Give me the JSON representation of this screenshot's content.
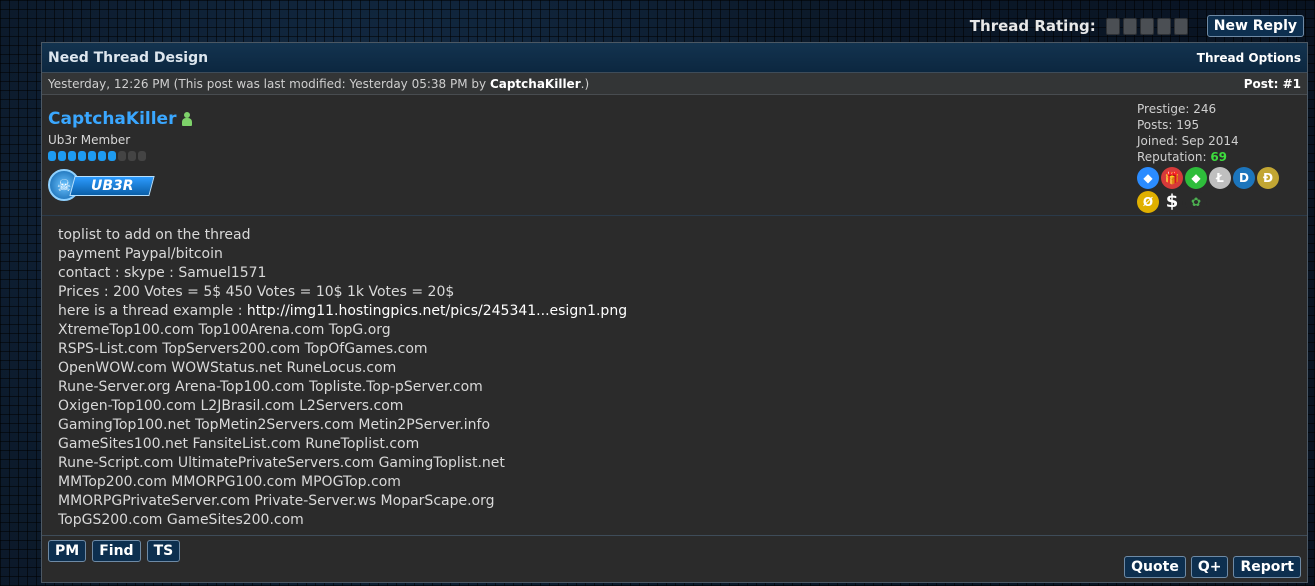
{
  "topbar": {
    "rating_label": "Thread Rating:",
    "new_reply": "New Reply"
  },
  "thread": {
    "title": "Need Thread Design",
    "options_label": "Thread Options"
  },
  "meta": {
    "date_text": "Yesterday, 12:26 PM (This post was last modified: Yesterday 05:38 PM by ",
    "modified_by": "CaptchaKiller",
    "date_suffix": ".)",
    "post_number": "Post: #1"
  },
  "author": {
    "username": "CaptchaKiller",
    "usertitle": "Ub3r Member",
    "group_badge": "UB3R",
    "stats": {
      "prestige": "Prestige: 246",
      "posts": "Posts: 195",
      "joined": "Joined: Sep 2014",
      "reputation_label": "Reputation:",
      "reputation_value": "69"
    },
    "rank_level": 7,
    "rank_max": 10,
    "awards": [
      {
        "icon": "diamond-icon",
        "color": "#2b8cff",
        "glyph": "◆"
      },
      {
        "icon": "gift-icon",
        "color": "#d63a3a",
        "glyph": "🎁"
      },
      {
        "icon": "emerald-icon",
        "color": "#2ebd3b",
        "glyph": "◆"
      },
      {
        "icon": "litecoin-icon",
        "color": "#bfbfbf",
        "glyph": "Ł"
      },
      {
        "icon": "dash-icon",
        "color": "#1c75bc",
        "glyph": "D"
      },
      {
        "icon": "dogecoin-icon",
        "color": "#c2a633",
        "glyph": "Ð"
      },
      {
        "icon": "zcash-icon",
        "color": "#e0b000",
        "glyph": "Ø"
      },
      {
        "icon": "dollar-icon",
        "color": "#2b2b2b",
        "glyph": "$"
      },
      {
        "icon": "leaf-icon",
        "color": "#2b2b2b",
        "glyph": "✿"
      }
    ]
  },
  "body": {
    "lines": [
      "toplist to add on the thread",
      "payment Paypal/bitcoin",
      "contact : skype : Samuel1571",
      "Prices : 200 Votes = 5$ 450 Votes = 10$ 1k Votes = 20$"
    ],
    "example_prefix": "here is a thread example : ",
    "example_link": "http://img11.hostingpics.net/pics/245341...esign1.png",
    "sites": [
      "XtremeTop100.com Top100Arena.com TopG.org",
      "RSPS-List.com TopServers200.com TopOfGames.com",
      "OpenWOW.com WOWStatus.net RuneLocus.com",
      "Rune-Server.org Arena-Top100.com Topliste.Top-pServer.com",
      "Oxigen-Top100.com L2JBrasil.com L2Servers.com",
      "GamingTop100.net TopMetin2Servers.com Metin2PServer.info",
      "GameSites100.net FansiteList.com RuneToplist.com",
      "Rune-Script.com UltimatePrivateServers.com GamingToplist.net",
      "MMTop200.com MMORPG100.com MPOGTop.com",
      "MMORPGPrivateServer.com Private-Server.ws MoparScape.org",
      "TopGS200.com GameSites200.com"
    ]
  },
  "footer": {
    "pm": "PM",
    "find": "Find",
    "ts": "TS",
    "quote": "Quote",
    "qplus": "Q+",
    "report": "Report"
  }
}
